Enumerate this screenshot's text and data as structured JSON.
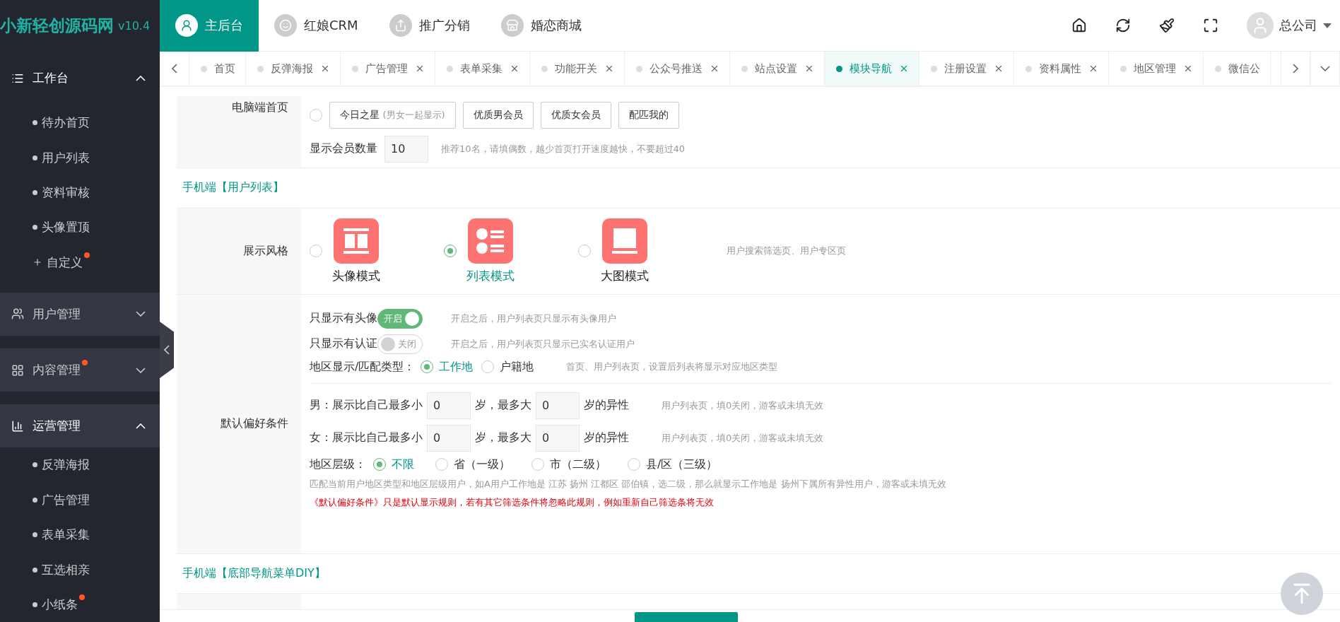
{
  "logo": {
    "name": "小新轻创源码网",
    "version": "v10.4"
  },
  "top_nav": [
    {
      "label": "主后台",
      "selected": true,
      "kind": "user"
    },
    {
      "label": "红娘CRM",
      "selected": false,
      "kind": "face"
    },
    {
      "label": "推广分销",
      "selected": false,
      "kind": "share"
    },
    {
      "label": "婚恋商城",
      "selected": false,
      "kind": "store"
    }
  ],
  "toolbar": [
    {
      "kind": "home"
    },
    {
      "kind": "refresh"
    },
    {
      "kind": "clean"
    },
    {
      "kind": "fullscreen"
    }
  ],
  "user": {
    "name": "总公司"
  },
  "sidebar": [
    {
      "label": "工作台",
      "kind": "workbench",
      "expanded": true,
      "dot": false,
      "children": [
        {
          "label": "待办首页",
          "kind": "dot",
          "dot": false
        },
        {
          "label": "用户列表",
          "kind": "dot",
          "dot": false
        },
        {
          "label": "资料审核",
          "kind": "dot",
          "dot": false
        },
        {
          "label": "头像置顶",
          "kind": "dot",
          "dot": false
        },
        {
          "label": "自定义",
          "kind": "plus",
          "dot": true
        }
      ]
    },
    {
      "label": "用户管理",
      "kind": "users",
      "expanded": false,
      "dot": false
    },
    {
      "label": "内容管理",
      "kind": "content",
      "expanded": false,
      "dot": true
    },
    {
      "label": "运营管理",
      "kind": "ops",
      "expanded": true,
      "dot": false,
      "children": [
        {
          "label": "反弹海报",
          "kind": "dot",
          "dot": false
        },
        {
          "label": "广告管理",
          "kind": "dot",
          "dot": false
        },
        {
          "label": "表单采集",
          "kind": "dot",
          "dot": false
        },
        {
          "label": "互选相亲",
          "kind": "dot",
          "dot": false
        },
        {
          "label": "小纸条",
          "kind": "dot",
          "dot": true
        }
      ]
    }
  ],
  "tabs": [
    {
      "label": "首页",
      "selected": false,
      "closable": false
    },
    {
      "label": "反弹海报",
      "selected": false,
      "closable": true
    },
    {
      "label": "广告管理",
      "selected": false,
      "closable": true
    },
    {
      "label": "表单采集",
      "selected": false,
      "closable": true
    },
    {
      "label": "功能开关",
      "selected": false,
      "closable": true
    },
    {
      "label": "公众号推送",
      "selected": false,
      "closable": true
    },
    {
      "label": "站点设置",
      "selected": false,
      "closable": true
    },
    {
      "label": "模块导航",
      "selected": true,
      "closable": true
    },
    {
      "label": "注册设置",
      "selected": false,
      "closable": true
    },
    {
      "label": "资料属性",
      "selected": false,
      "closable": true
    },
    {
      "label": "地区管理",
      "selected": false,
      "closable": true
    },
    {
      "label": "微信公",
      "selected": false,
      "closable": false
    }
  ],
  "pc_home": {
    "label": "电脑端首页",
    "selected": false,
    "options": [
      {
        "label": "今日之星",
        "hint": "(男女一起显示)"
      },
      {
        "label": "优质男会员"
      },
      {
        "label": "优质女会员"
      },
      {
        "label": "配匹我的"
      }
    ],
    "count_label": "显示会员数量",
    "count_value": "10",
    "count_hint": "推荐10名，请填偶数，越少首页打开速度越快，不要超过40"
  },
  "section_user_list": "手机端【用户列表】",
  "display_style": {
    "label": "展示风格",
    "options": [
      {
        "label": "头像模式",
        "kind": "avatar",
        "selected": false
      },
      {
        "label": "列表模式",
        "kind": "list",
        "selected": true
      },
      {
        "label": "大图模式",
        "kind": "big",
        "selected": false
      }
    ],
    "hint": "用户搜索筛选页、用户专区页"
  },
  "filters": {
    "switches": [
      {
        "label": "只显示有头像",
        "on": true,
        "text": "开启",
        "hint": "开启之后，用户列表页只显示有头像用户"
      },
      {
        "label": "只显示有认证",
        "on": false,
        "text": "关闭",
        "hint": "开启之后，用户列表页只显示已实名认证用户"
      }
    ],
    "region_type": {
      "label": "地区显示/匹配类型：",
      "options": [
        {
          "label": "工作地",
          "selected": true
        },
        {
          "label": "户籍地",
          "selected": false
        }
      ],
      "hint": "首页、用户列表页，设置后列表将显示对应地区类型"
    }
  },
  "preferences": {
    "label": "默认偏好条件",
    "rows": [
      {
        "prefix": "男：展示比自己最多小",
        "min": "0",
        "middle": "岁，最多大",
        "max": "0",
        "suffix": "岁的异性",
        "hint": "用户列表页，填0关闭，游客或未填无效"
      },
      {
        "prefix": "女：展示比自己最多小",
        "min": "0",
        "middle": "岁，最多大",
        "max": "0",
        "suffix": "岁的异性",
        "hint": "用户列表页，填0关闭，游客或未填无效"
      }
    ],
    "region_level": {
      "label": "地区层级：",
      "options": [
        {
          "label": "不限",
          "selected": true
        },
        {
          "label": "省（一级）",
          "selected": false
        },
        {
          "label": "市（二级）",
          "selected": false
        },
        {
          "label": "县/区（三级）",
          "selected": false
        }
      ]
    },
    "note": "匹配当前用户地区类型和地区层级用户，如A用户工作地是 江苏 扬州 江都区 邵伯镇，选二级，那么就显示工作地是 扬州下属所有异性用户，游客或未填无效",
    "warning": "《默认偏好条件》只是默认显示规则，若有其它筛选条件将忽略此规则，例如重新自己筛选条将无效"
  },
  "section_bottom_nav": "手机端【底部导航菜单DIY】"
}
